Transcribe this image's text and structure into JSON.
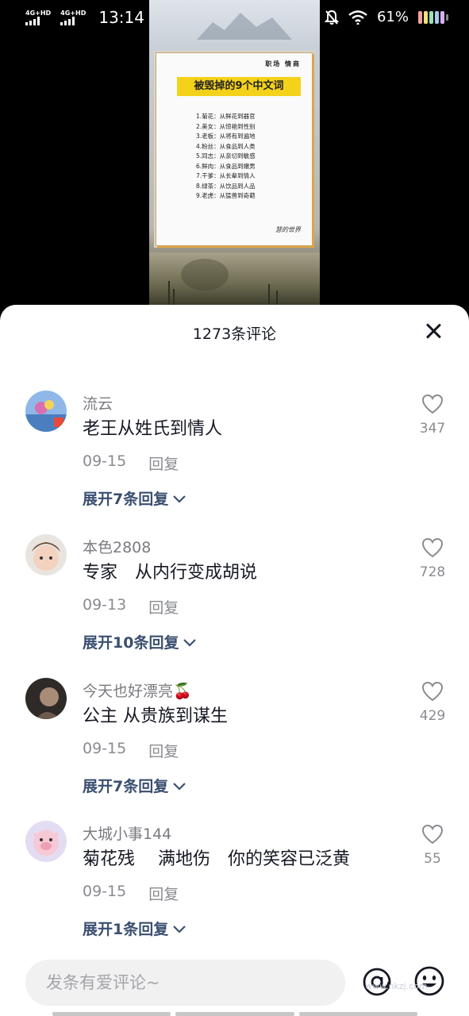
{
  "status_bar": {
    "network_1": "4G+HD",
    "network_2": "4G+HD",
    "time": "13:14",
    "notification_icon": "S",
    "battery_percent": "61%",
    "icons": [
      "mute-bell-icon",
      "wifi-icon",
      "battery-icon"
    ]
  },
  "video": {
    "header": "职场 情商",
    "title": "被毁掉的9个中文词",
    "items": [
      "1.菊花：从鲜花到器官",
      "2.美女：从惊艳到性别",
      "3.老板：从将有到遍地",
      "4.粉丝：从食品到人类",
      "5.同志：从亲切到敏感",
      "6.鲜肉：从食品到嫩男",
      "7.干爹：从长辈到情人",
      "8.绿茶：从饮品到人品",
      "9.老虎：从猛兽到奇葩"
    ],
    "signature": "慧的世界"
  },
  "comments_panel": {
    "title": "1273条评论",
    "close_icon": "close-icon",
    "reply_label": "回复",
    "comments": [
      {
        "user": "流云",
        "text": "老王从姓氏到情人",
        "date": "09-15",
        "likes": "347",
        "expand": "展开7条回复"
      },
      {
        "user": "本色2808",
        "text": "专家　从内行变成胡说",
        "date": "09-13",
        "likes": "728",
        "expand": "展开10条回复"
      },
      {
        "user": "今天也好漂亮🍒",
        "text": "公主 从贵族到谋生",
        "date": "09-15",
        "likes": "429",
        "expand": "展开7条回复"
      },
      {
        "user": "大城小事144",
        "text": "菊花残　 满地伤　你的笑容已泛黄",
        "date": "09-15",
        "likes": "55",
        "expand": "展开1条回复"
      }
    ]
  },
  "input": {
    "placeholder": "发条有爱评论~",
    "at_icon": "at-icon",
    "emoji_icon": "emoji-icon"
  },
  "watermark": "www.nkzj.com"
}
